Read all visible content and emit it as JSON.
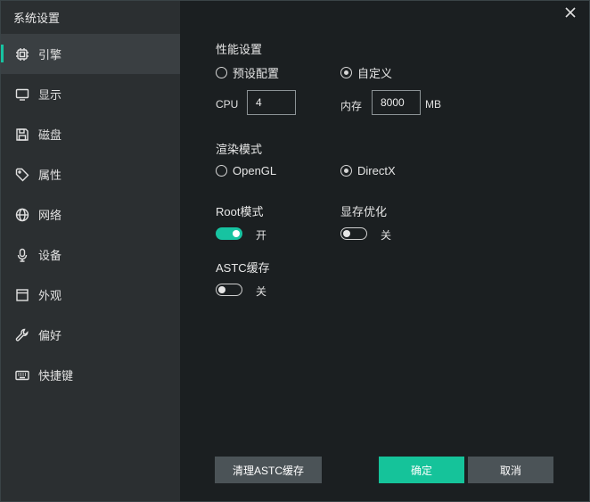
{
  "window": {
    "title": "系统设置"
  },
  "sidebar": {
    "items": [
      {
        "label": "引擎",
        "icon": "chip-icon",
        "active": true
      },
      {
        "label": "显示",
        "icon": "monitor-icon"
      },
      {
        "label": "磁盘",
        "icon": "save-disk-icon"
      },
      {
        "label": "属性",
        "icon": "tag-icon"
      },
      {
        "label": "网络",
        "icon": "globe-icon"
      },
      {
        "label": "设备",
        "icon": "microphone-icon"
      },
      {
        "label": "外观",
        "icon": "window-frame-icon"
      },
      {
        "label": "偏好",
        "icon": "wrench-icon"
      },
      {
        "label": "快捷键",
        "icon": "keyboard-icon"
      }
    ]
  },
  "performance": {
    "title": "性能设置",
    "options": [
      {
        "label": "预设配置",
        "checked": false
      },
      {
        "label": "自定义",
        "checked": true
      }
    ],
    "cpu_label": "CPU",
    "cpu_value": "4",
    "memory_label": "内存",
    "memory_value": "8000",
    "memory_unit": "MB"
  },
  "render": {
    "title": "渲染模式",
    "options": [
      {
        "label": "OpenGL",
        "checked": false
      },
      {
        "label": "DirectX",
        "checked": true
      }
    ]
  },
  "toggles": {
    "root": {
      "title": "Root模式",
      "state_label": "开",
      "on": true
    },
    "vram": {
      "title": "显存优化",
      "state_label": "关",
      "on": false
    },
    "astc": {
      "title": "ASTC缓存",
      "state_label": "关",
      "on": false
    }
  },
  "buttons": {
    "clear_astc": "清理ASTC缓存",
    "confirm": "确定",
    "cancel": "取消"
  },
  "colors": {
    "accent": "#17c3a1",
    "primary_button": "#15c39a",
    "secondary_button": "#4b5357",
    "sidebar_bg": "#2b2f31",
    "content_bg": "#1b1f21"
  }
}
